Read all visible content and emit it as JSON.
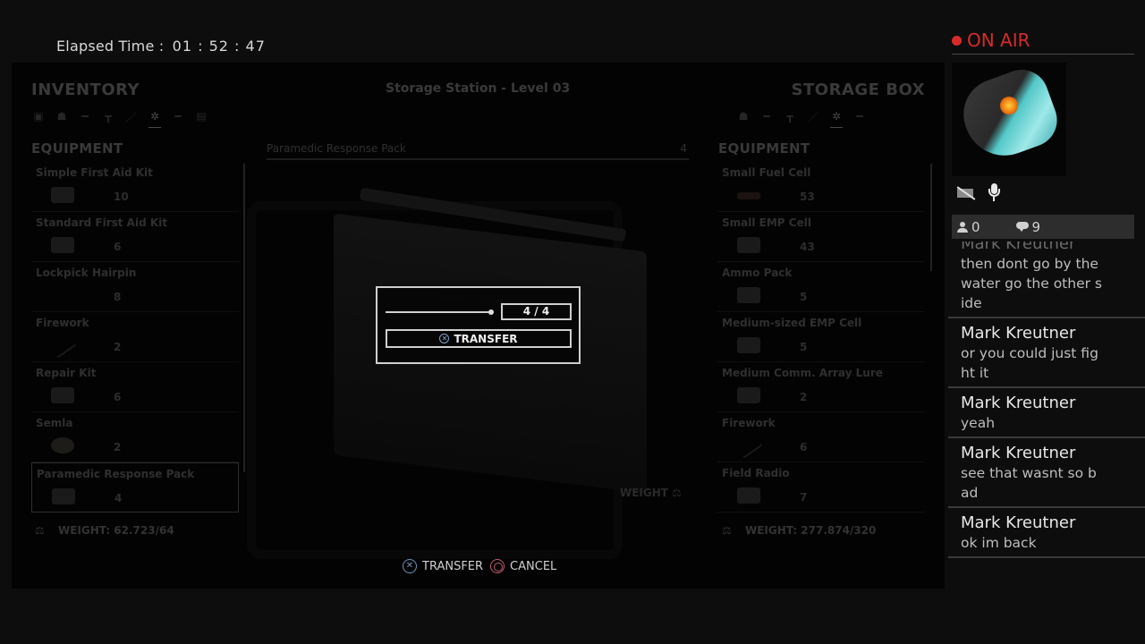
{
  "elapsed": {
    "label": "Elapsed Time :",
    "value": "01 : 52 : 47"
  },
  "game": {
    "left_panel": {
      "title": "INVENTORY",
      "tabs": [
        "document-tab",
        "backpack-tab",
        "rifle-tab",
        "pistol-tab",
        "melee-tab",
        "equipment-tab",
        "shotgun-tab",
        "ammo-tab"
      ],
      "active_tab": "equipment-tab",
      "section": "EQUIPMENT",
      "items": [
        {
          "name": "Simple First Aid Kit",
          "qty": "10"
        },
        {
          "name": "Standard First Aid Kit",
          "qty": "6"
        },
        {
          "name": "Lockpick Hairpin",
          "qty": "8"
        },
        {
          "name": "Firework",
          "qty": "2"
        },
        {
          "name": "Repair Kit",
          "qty": "6"
        },
        {
          "name": "Semla",
          "qty": "2"
        },
        {
          "name": "Paramedic Response Pack",
          "qty": "4",
          "selected": true
        }
      ],
      "weight": "WEIGHT: 62.723/64"
    },
    "center": {
      "title": "Storage Station - Level 03",
      "item_name": "Paramedic Response Pack",
      "item_count": "4",
      "weight_label": "WEIGHT",
      "modal": {
        "slider_value": 1.0,
        "quantity": "4 / 4",
        "button_label": "TRANSFER"
      },
      "hints": [
        {
          "button": "cross",
          "label": "TRANSFER"
        },
        {
          "button": "circle",
          "label": "CANCEL"
        }
      ]
    },
    "right_panel": {
      "title": "STORAGE BOX",
      "tabs": [
        "backpack-tab",
        "rifle-tab",
        "pistol-tab",
        "melee-tab",
        "equipment-tab",
        "shotgun-tab"
      ],
      "active_tab": "equipment-tab",
      "section": "EQUIPMENT",
      "items": [
        {
          "name": "Small Fuel Cell",
          "qty": "53"
        },
        {
          "name": "Small EMP Cell",
          "qty": "43"
        },
        {
          "name": "Ammo Pack",
          "qty": "5"
        },
        {
          "name": "Medium-sized EMP Cell",
          "qty": "5"
        },
        {
          "name": "Medium Comm. Array Lure",
          "qty": "2"
        },
        {
          "name": "Firework",
          "qty": "6"
        },
        {
          "name": "Field Radio",
          "qty": "7"
        }
      ],
      "weight": "WEIGHT: 277.874/320"
    }
  },
  "broadcast": {
    "status": "ON AIR",
    "status_color": "#d62b2b",
    "viewers": "0",
    "comments": "9",
    "chat": [
      {
        "author": "Mark Kreutner",
        "text": "then dont go by the water go the other side"
      },
      {
        "author": "Mark Kreutner",
        "text": "or you could just fight it"
      },
      {
        "author": "Mark Kreutner",
        "text": "yeah"
      },
      {
        "author": "Mark Kreutner",
        "text": "see that wasnt so bad"
      },
      {
        "author": "Mark Kreutner",
        "text": "ok im back"
      }
    ]
  }
}
